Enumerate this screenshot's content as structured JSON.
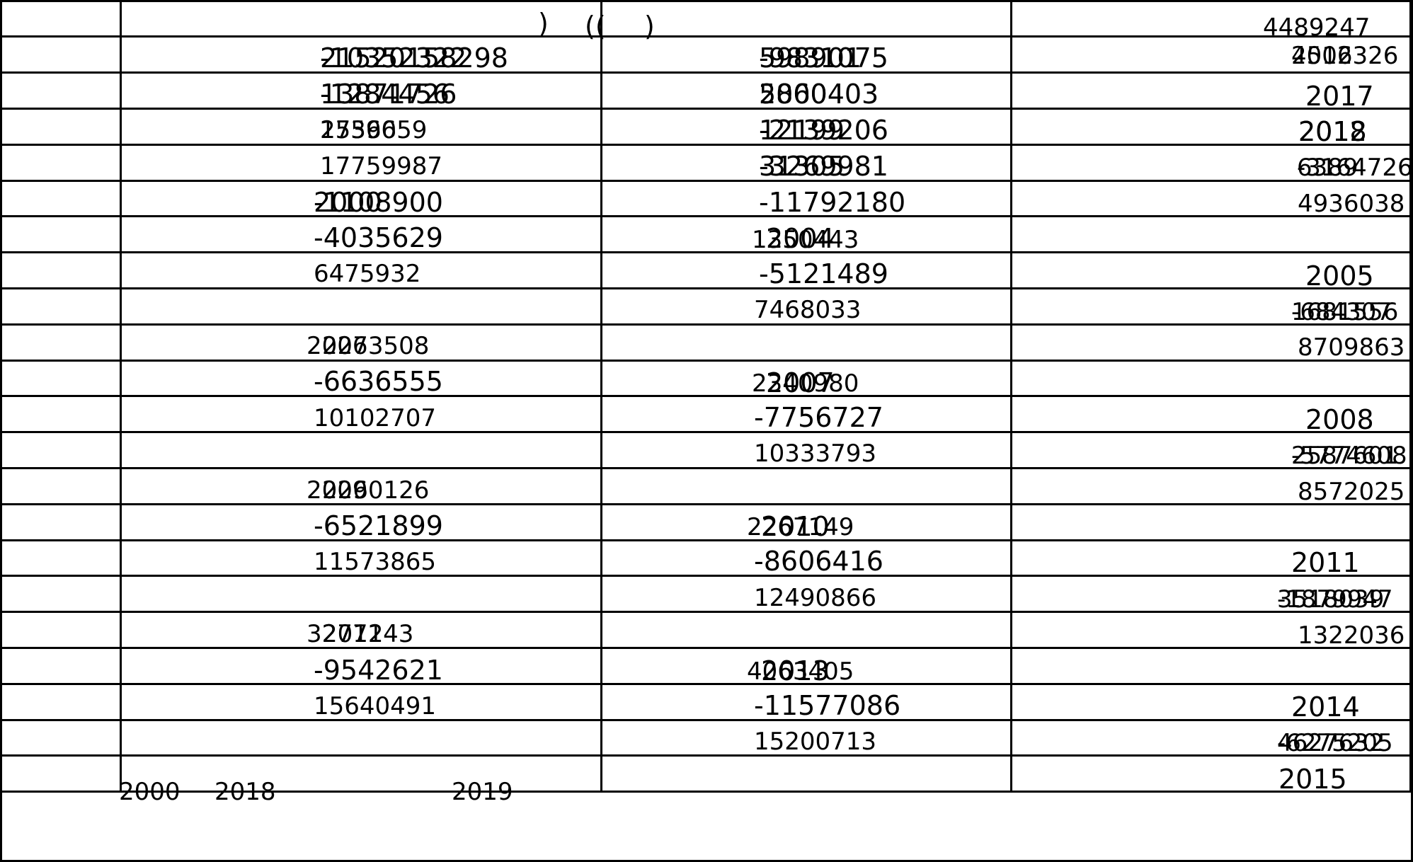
{
  "table": {
    "header": {
      "paren1": ")",
      "paren2": "((",
      "paren3": ")",
      "top_right": "4489247"
    },
    "col1": {
      "a1": "21520158298",
      "a1b": "-10352322",
      "a2": "-1284456",
      "a2b": "13871726",
      "a3": "2536059",
      "a3b": "17596",
      "a4": "17759987",
      "a5": "2000",
      "a5b": "-1108900",
      "a6": "-4035629",
      "a7": "6475932",
      "a8": "2006",
      "a8b": "2273508",
      "a9": "-6636555",
      "a10": "10102707",
      "a11": "2009",
      "a11b": "2260126",
      "a12": "-6521899",
      "a13": "11573865",
      "a14": "2012",
      "a14b": "3277143",
      "a15": "-9542621",
      "a16": "15640491",
      "foot1": "2000",
      "foot2": "2018",
      "foot3": "2019"
    },
    "col2": {
      "b1": "-9831075",
      "b1b": "598901",
      "b2": "2000403",
      "b2b": "5860",
      "b3": "-2139206",
      "b3b": "12199",
      "b4": "-3269981",
      "b4b": "31305",
      "b5": "-11792180",
      "b6": "2004",
      "b6b": "1350443",
      "b7": "-5121489",
      "b8": "7468033",
      "b9": "2007",
      "b9b": "2340980",
      "b10": "-7756727",
      "b11": "10333793",
      "b12": "2010",
      "b12b": "2267149",
      "b13": "-8606416",
      "b14": "12490866",
      "b15": "2013",
      "b15b": "4063405",
      "b16": "-11577086",
      "b17": "15200713"
    },
    "col3": {
      "c1": "4516326",
      "c1b": "2002",
      "c2": "2017",
      "c3": "2018",
      "c3b": "2012",
      "c4": "-3164726",
      "c4b": "6389",
      "c5": "4936038",
      "c6": "2005",
      "c7": "-684307",
      "c7b": "1681556",
      "c8": "8709863",
      "c9": "2008",
      "c10": "-5774608",
      "c10b": "2587601",
      "c11": "8572025",
      "c12": "2011",
      "c13": "-1879947",
      "c13b": "3518039",
      "c14": "1322036",
      "c15": "2014",
      "c16": "-6275205",
      "c16b": "4627632",
      "c17": "2015"
    }
  }
}
